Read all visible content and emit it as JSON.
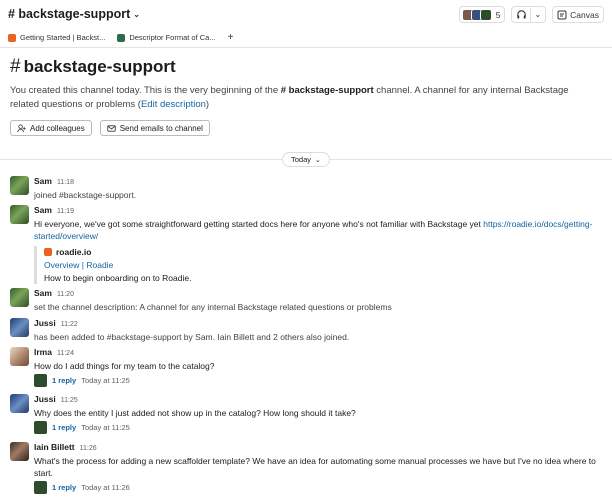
{
  "header": {
    "channel_name": "# backstage-support",
    "member_count": "5",
    "canvas_label": "Canvas"
  },
  "tabs": [
    {
      "label": "Getting Started | Backst...",
      "icon": "backstage-icon"
    },
    {
      "label": "Descriptor Format of Ca...",
      "icon": "doc-icon"
    }
  ],
  "intro": {
    "title": "backstage-support",
    "text_prefix": "You created this channel today. This is the very beginning of the ",
    "channel_ref": "# backstage-support",
    "text_suffix": " channel. A channel for any internal Backstage related questions or problems (",
    "edit_link": "Edit description",
    "text_close": ")",
    "add_colleagues": "Add colleagues",
    "send_emails": "Send emails to channel"
  },
  "day_divider": "Today",
  "messages": [
    {
      "author": "Sam",
      "time": "11:18",
      "text": "joined #backstage-support."
    },
    {
      "author": "Sam",
      "time": "11:19",
      "text": "Hi everyone, we've got some straightforward getting started docs here for anyone who's not familiar with Backstage yet ",
      "link": "https://roadie.io/docs/getting-started/overview/",
      "unfurl": {
        "site": "roadie.io",
        "title": "Overview | Roadie",
        "desc": "How to begin onboarding on to Roadie."
      }
    },
    {
      "author": "Sam",
      "time": "11:20",
      "text": "set the channel description: A channel for any internal Backstage related questions or problems"
    },
    {
      "author": "Jussi",
      "time": "11:22",
      "text": "has been added to #backstage-support by Sam. Iain Billett and 2 others also joined."
    },
    {
      "author": "Irma",
      "time": "11:24",
      "text": "How do I add things for my team to the catalog?",
      "replies": "1 reply",
      "last_reply": "Today at 11:25"
    },
    {
      "author": "Jussi",
      "time": "11:25",
      "text": "Why does the entity I just added not show up in the catalog? How long should it take?",
      "replies": "1 reply",
      "last_reply": "Today at 11:25"
    },
    {
      "author": "Iain Billett",
      "time": "11:26",
      "text": "What's the process for adding a new scaffolder template? We have an idea for automating some manual processes we have but I've no idea where to start.",
      "replies": "1 reply",
      "last_reply": "Today at 11:26"
    }
  ],
  "colors": {
    "link": "#1264a3",
    "text": "#1d1c1d",
    "muted": "#616061"
  }
}
